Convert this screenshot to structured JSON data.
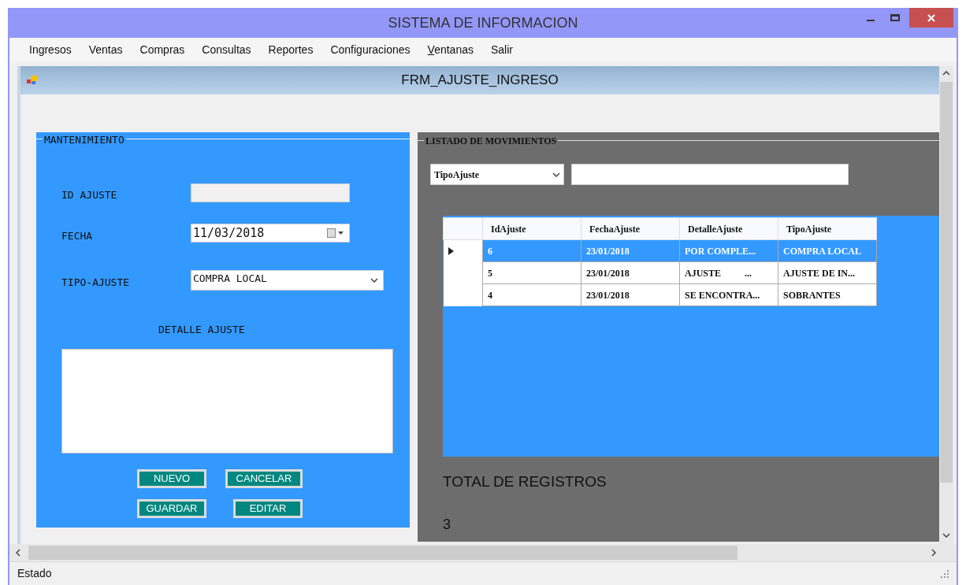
{
  "window": {
    "title": "SISTEMA DE INFORMACION"
  },
  "menu": [
    {
      "label": "Ingresos",
      "mnemonic_underlined": false
    },
    {
      "label": "Ventas",
      "mnemonic_underlined": false
    },
    {
      "label": "Compras",
      "mnemonic_underlined": false
    },
    {
      "label": "Consultas",
      "mnemonic_underlined": false
    },
    {
      "label": "Reportes",
      "mnemonic_underlined": false
    },
    {
      "label": "Configuraciones",
      "mnemonic_underlined": false
    },
    {
      "label": "Ventanas",
      "mnemonic_underlined": true
    },
    {
      "label": "Salir",
      "mnemonic_underlined": false
    }
  ],
  "child_window": {
    "title": "FRM_AJUSTE_INGRESO"
  },
  "mantenimiento": {
    "title": "MANTENIMIENTO",
    "fields": [
      {
        "kind": "text",
        "label": "ID AJUSTE",
        "disabled": true
      },
      {
        "kind": "date",
        "label": "FECHA",
        "value": "11/03/2018"
      },
      {
        "kind": "select",
        "label": "TIPO-AJUSTE",
        "value": "COMPRA LOCAL"
      }
    ],
    "detail_label": "DETALLE AJUSTE",
    "buttons": [
      "NUEVO",
      "CANCELAR",
      "GUARDAR",
      "EDITAR"
    ]
  },
  "listado": {
    "title": "LISTADO DE MOVIMIENTOS",
    "filter": {
      "value": "TipoAjuste"
    },
    "table": {
      "columns": [
        "IdAjuste",
        "FechaAjuste",
        "DetalleAjuste",
        "TipoAjuste"
      ],
      "rows": [
        {
          "selected": true,
          "cells": [
            "6",
            "23/01/2018",
            "POR COMPLE...",
            "COMPRA LOCAL"
          ]
        },
        {
          "selected": false,
          "cells": [
            "5",
            "23/01/2018",
            "AJUSTE          ...",
            "AJUSTE DE IN..."
          ]
        },
        {
          "selected": false,
          "cells": [
            "4",
            "23/01/2018",
            "SE ENCONTRA...",
            "SOBRANTES"
          ]
        }
      ]
    },
    "total_label": "TOTAL DE REGISTROS",
    "total_value": "3"
  },
  "status_bar": {
    "text": "Estado"
  }
}
